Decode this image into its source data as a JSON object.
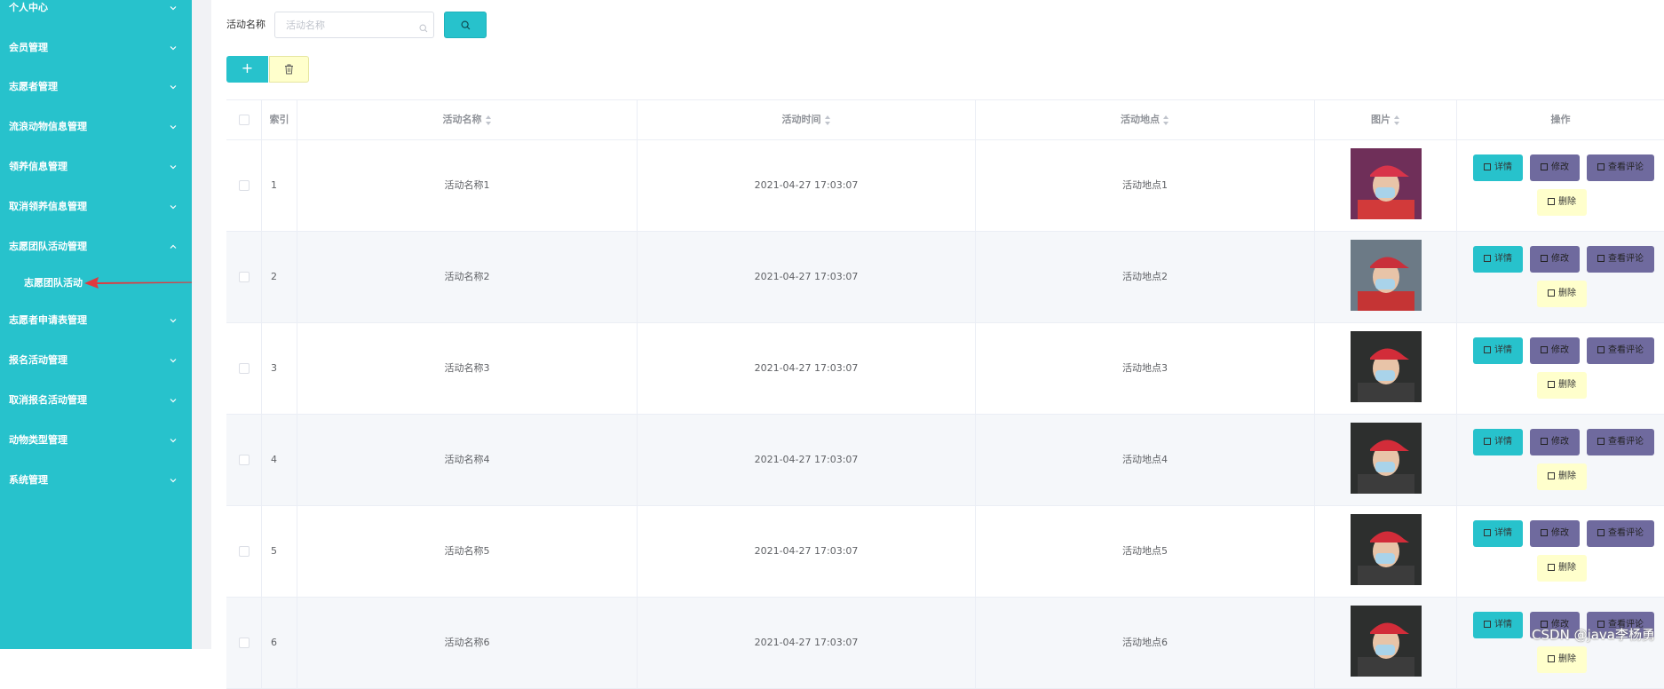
{
  "sidebar": {
    "items": [
      {
        "label": "个人中心",
        "expanded": false
      },
      {
        "label": "会员管理",
        "expanded": false
      },
      {
        "label": "志愿者管理",
        "expanded": false
      },
      {
        "label": "流浪动物信息管理",
        "expanded": false
      },
      {
        "label": "领养信息管理",
        "expanded": false
      },
      {
        "label": "取消领养信息管理",
        "expanded": false
      },
      {
        "label": "志愿团队活动管理",
        "expanded": true
      },
      {
        "label": "志愿者申请表管理",
        "expanded": false
      },
      {
        "label": "报名活动管理",
        "expanded": false
      },
      {
        "label": "取消报名活动管理",
        "expanded": false
      },
      {
        "label": "动物类型管理",
        "expanded": false
      },
      {
        "label": "系统管理",
        "expanded": false
      }
    ],
    "submenu": {
      "label": "志愿团队活动"
    }
  },
  "search": {
    "label": "活动名称",
    "placeholder": "活动名称",
    "value": ""
  },
  "toolbar": {
    "add_label": "+"
  },
  "table": {
    "headers": {
      "index": "索引",
      "name": "活动名称",
      "time": "活动时间",
      "place": "活动地点",
      "image": "图片",
      "actions": "操作"
    },
    "rows": [
      {
        "index": "1",
        "name": "活动名称1",
        "time": "2021-04-27 17:03:07",
        "place": "活动地点1"
      },
      {
        "index": "2",
        "name": "活动名称2",
        "time": "2021-04-27 17:03:07",
        "place": "活动地点2"
      },
      {
        "index": "3",
        "name": "活动名称3",
        "time": "2021-04-27 17:03:07",
        "place": "活动地点3"
      },
      {
        "index": "4",
        "name": "活动名称4",
        "time": "2021-04-27 17:03:07",
        "place": "活动地点4"
      },
      {
        "index": "5",
        "name": "活动名称5",
        "time": "2021-04-27 17:03:07",
        "place": "活动地点5"
      },
      {
        "index": "6",
        "name": "活动名称6",
        "time": "2021-04-27 17:03:07",
        "place": "活动地点6"
      }
    ],
    "action_labels": {
      "detail": "详情",
      "edit": "修改",
      "comment": "查看评论",
      "remove": "删除"
    }
  },
  "watermark": "CSDN @java李杨勇",
  "colors": {
    "primary": "#27c2cc",
    "purple": "#6f6a9e",
    "warn": "#ffffcc",
    "annotation_arrow": "#e0393e"
  }
}
